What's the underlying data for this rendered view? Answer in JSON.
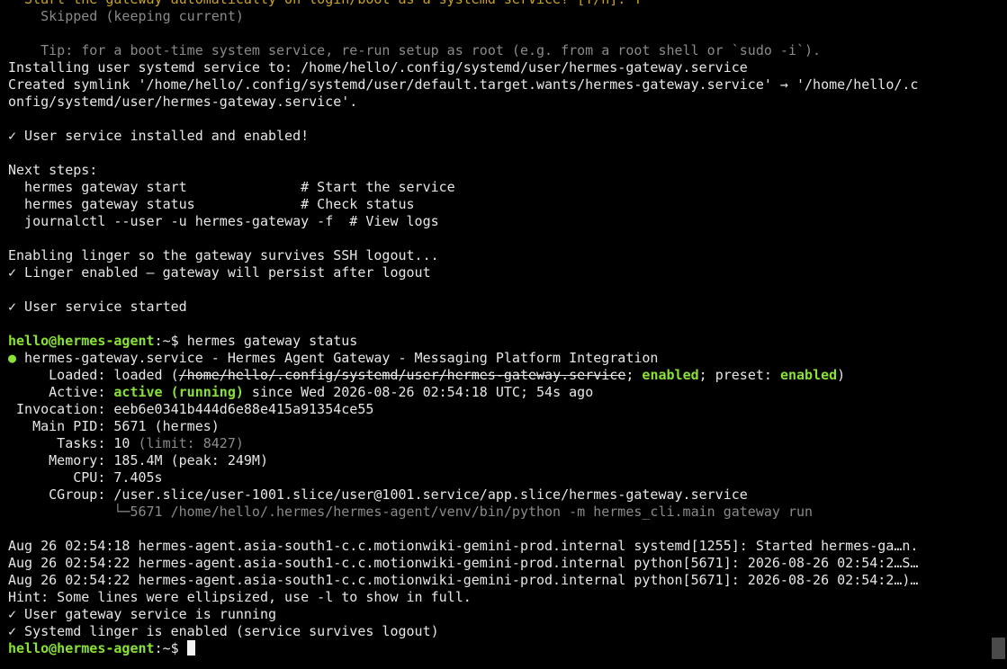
{
  "lines": [
    {
      "text": "  Start the gateway automatically on login/boot as a systemd service? [Y/n]: Y",
      "style": "yellow"
    },
    {
      "text": "    Skipped (keeping current)",
      "style": "dim"
    },
    {
      "text": "",
      "style": ""
    },
    {
      "text": "    Tip: for a boot-time system service, re-run setup as root (e.g. from a root shell or `sudo -i`).",
      "style": "dim"
    },
    {
      "text": "Installing user systemd service to: /home/hello/.config/systemd/user/hermes-gateway.service",
      "style": ""
    },
    {
      "text": "Created symlink '/home/hello/.config/systemd/user/default.target.wants/hermes-gateway.service' → '/home/hello/.c",
      "style": ""
    },
    {
      "text": "onfig/systemd/user/hermes-gateway.service'.",
      "style": ""
    },
    {
      "text": "",
      "style": ""
    },
    {
      "text": "✓ User service installed and enabled!",
      "style": ""
    },
    {
      "text": "",
      "style": ""
    },
    {
      "text": "Next steps:",
      "style": ""
    },
    {
      "text": "  hermes gateway start              # Start the service",
      "style": ""
    },
    {
      "text": "  hermes gateway status             # Check status",
      "style": ""
    },
    {
      "text": "  journalctl --user -u hermes-gateway -f  # View logs",
      "style": ""
    },
    {
      "text": "",
      "style": ""
    },
    {
      "text": "Enabling linger so the gateway survives SSH logout...",
      "style": ""
    },
    {
      "text": "✓ Linger enabled — gateway will persist after logout",
      "style": ""
    },
    {
      "text": "",
      "style": ""
    },
    {
      "text": "✓ User service started",
      "style": ""
    },
    {
      "text": "",
      "style": ""
    }
  ],
  "prompt": {
    "user_host": "hello@hermes-agent",
    "path": ":~$ ",
    "command": "hermes gateway status"
  },
  "status": {
    "bullet": "●",
    "unit_line": " hermes-gateway.service - Hermes Agent Gateway - Messaging Platform Integration",
    "loaded_label": "     Loaded: ",
    "loaded_value": "loaded (",
    "loaded_path": "/home/hello/.config/systemd/user/hermes-gateway.service",
    "loaded_sep1": "; ",
    "loaded_enabled": "enabled",
    "loaded_sep2": "; preset: ",
    "loaded_preset": "enabled",
    "loaded_end": ")",
    "active_label": "     Active: ",
    "active_value": "active (running)",
    "active_rest": " since Wed 2026-08-26 02:54:18 UTC; 54s ago",
    "invocation": " Invocation: eeb6e0341b444d6e88e415a91354ce55",
    "main_pid": "   Main PID: 5671 (hermes)",
    "tasks_label": "      Tasks: 10",
    "tasks_limit": " (limit: 8427)",
    "memory": "     Memory: 185.4M (peak: 249M)",
    "cpu": "        CPU: 7.405s",
    "cgroup": "     CGroup: /user.slice/user-1001.slice/user@1001.service/app.slice/hermes-gateway.service",
    "cgroup_child": "             └─5671 /home/hello/.hermes/hermes-agent/venv/bin/python -m hermes_cli.main gateway run"
  },
  "logs": [
    "Aug 26 02:54:18 hermes-agent.asia-south1-c.c.motionwiki-gemini-prod.internal systemd[1255]: Started hermes-ga…n.",
    "Aug 26 02:54:22 hermes-agent.asia-south1-c.c.motionwiki-gemini-prod.internal python[5671]: 2026-08-26 02:54:2…S…",
    "Aug 26 02:54:22 hermes-agent.asia-south1-c.c.motionwiki-gemini-prod.internal python[5671]: 2026-08-26 02:54:2…)…",
    "Hint: Some lines were ellipsized, use -l to show in full.",
    "✓ User gateway service is running",
    "✓ Systemd linger is enabled (service survives logout)"
  ],
  "final_prompt": {
    "user_host": "hello@hermes-agent",
    "path": ":~$ "
  },
  "colors": {
    "background": "#000000",
    "text": "#e6e6e6",
    "green": "#8ae234",
    "yellow": "#c9a227",
    "dim": "#8a8a8a"
  }
}
